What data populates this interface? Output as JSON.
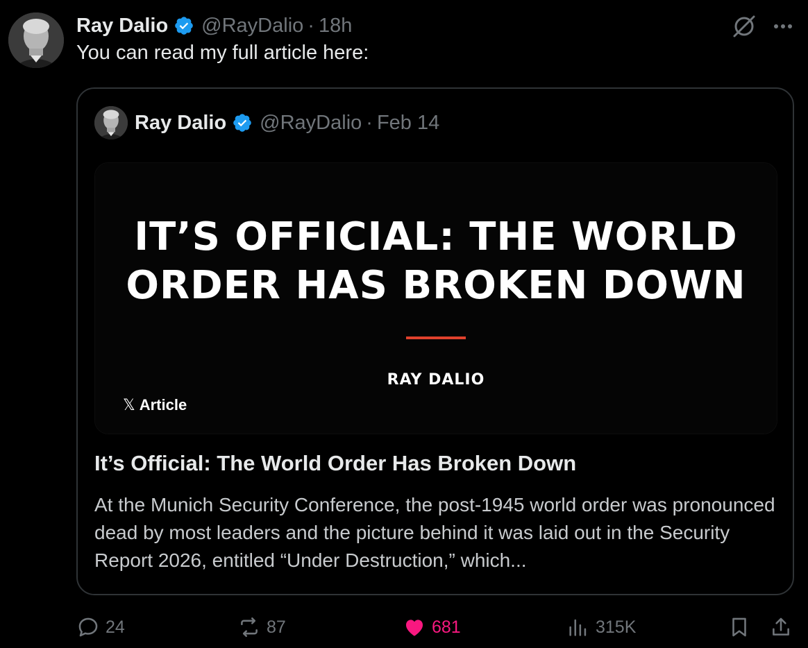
{
  "post": {
    "author_name": "Ray Dalio",
    "author_handle": "@RayDalio",
    "separator": "·",
    "time": "18h",
    "text": "You can read my full article here:"
  },
  "quote": {
    "author_name": "Ray Dalio",
    "author_handle": "@RayDalio",
    "separator": "·",
    "date": "Feb 14",
    "image": {
      "headline_line1": "IT’S OFFICIAL: THE WORLD",
      "headline_line2": "ORDER HAS BROKEN DOWN",
      "byline": "RAY DALIO",
      "badge_logo": "𝕏",
      "badge_label": "Article"
    },
    "article_title": "It’s Official: The World Order Has Broken Down",
    "article_snippet": "At the Munich Security Conference, the post-1945 world order was pronounced dead by most leaders and the picture behind it was laid out in the Security Report 2026, entitled “Under Destruction,” which..."
  },
  "actions": {
    "replies": "24",
    "reposts": "87",
    "likes": "681",
    "views": "315K"
  },
  "icons": {
    "verified": "verified-badge-icon",
    "grok": "grok-icon",
    "more": "more-icon",
    "reply": "reply-icon",
    "repost": "repost-icon",
    "like": "heart-icon",
    "views": "views-icon",
    "bookmark": "bookmark-icon",
    "share": "share-icon"
  },
  "colors": {
    "background": "#000000",
    "text_primary": "#e7e9ea",
    "text_secondary": "#71767b",
    "verified_blue": "#1d9bf0",
    "like_pink": "#f91880",
    "accent_red": "#e0412c",
    "card_border": "#2f3336"
  }
}
